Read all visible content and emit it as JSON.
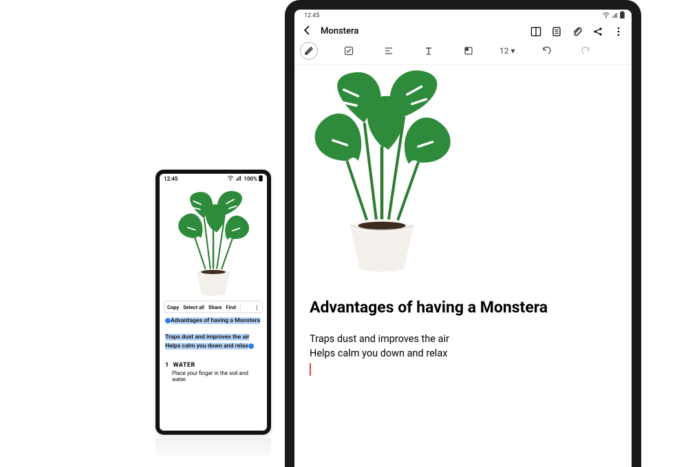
{
  "phone": {
    "status": {
      "time": "12:45",
      "battery": "100%"
    },
    "context_menu": {
      "copy": "Copy",
      "select_all": "Select all",
      "share": "Share",
      "find": "Find"
    },
    "note": {
      "title": "Advantages of having a Monstera",
      "line1": "Traps dust and improves the air",
      "line2": "Helps calm you down and relax"
    },
    "section": {
      "number": "1",
      "heading": "WATER",
      "sub": "Place your finger in the soil and water."
    }
  },
  "tablet": {
    "status": {
      "time": "12:45"
    },
    "header": {
      "title": "Monstera"
    },
    "toolbar": {
      "font_size": "12"
    },
    "article": {
      "title": "Advantages of having a Monstera",
      "line1": "Traps dust and improves the air",
      "line2": "Helps calm you down and relax"
    }
  },
  "colors": {
    "selection": "#b7d4f8",
    "caret": "#e53935"
  }
}
